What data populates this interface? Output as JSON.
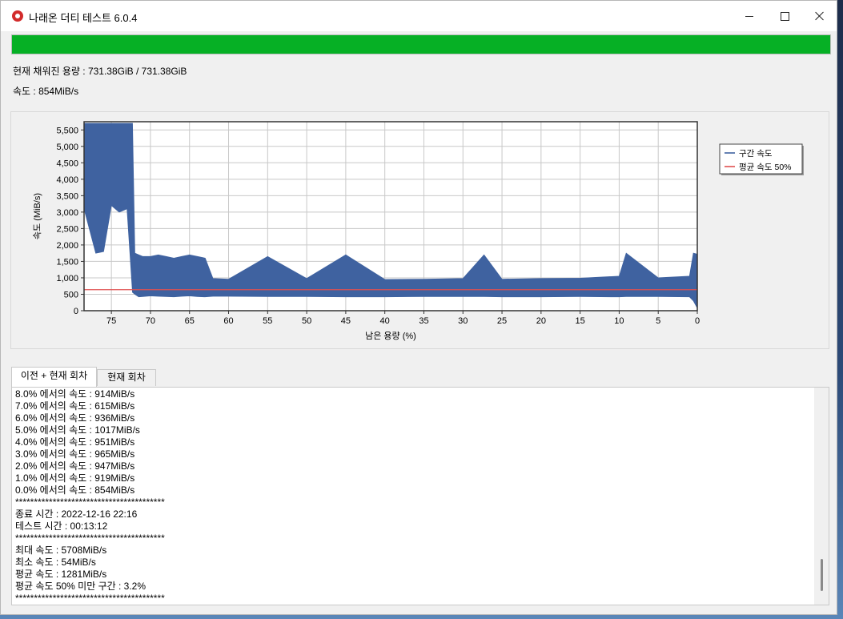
{
  "window": {
    "title": "나래온 더티 테스트 6.0.4",
    "icon": "app-logo-icon"
  },
  "controls": {
    "minimize_icon": "minimize-icon",
    "maximize_icon": "maximize-icon",
    "close_icon": "close-icon"
  },
  "progress": {
    "value": 1.0,
    "color": "#06b025"
  },
  "status": {
    "filled": "현재 채워진 용량 : 731.38GiB / 731.38GiB",
    "speed": "속도 : 854MiB/s"
  },
  "chart_data": {
    "type": "line",
    "xlabel": "남은 용량 (%)",
    "ylabel": "속도 (MiB/s)",
    "xlim": [
      78.5,
      0
    ],
    "ylim": [
      0,
      5750
    ],
    "x_ticks": [
      75,
      70,
      65,
      60,
      55,
      50,
      45,
      40,
      35,
      30,
      25,
      20,
      15,
      10,
      5,
      0
    ],
    "y_ticks": [
      0,
      500,
      1000,
      1500,
      2000,
      2500,
      3000,
      3500,
      4000,
      4500,
      5000,
      5500
    ],
    "y_tick_labels": [
      "0",
      "500",
      "1,000",
      "1,500",
      "2,000",
      "2,500",
      "3,000",
      "3,500",
      "4,000",
      "4,500",
      "5,000",
      "5,500"
    ],
    "grid": true,
    "legend_placement": "right",
    "series": [
      {
        "name": "구간 속도",
        "color": "#3f62a0",
        "x": [
          78.5,
          77,
          76,
          75,
          74,
          73,
          72.3,
          72,
          71.5,
          71,
          70,
          69,
          68,
          67,
          66,
          65,
          64,
          63,
          62,
          60,
          55,
          50,
          45,
          40,
          35,
          30,
          27.3,
          25,
          20,
          15,
          10,
          9.1,
          5,
          1,
          0.5,
          0
        ],
        "min": [
          3100,
          1750,
          1800,
          3200,
          3000,
          3100,
          560,
          500,
          420,
          430,
          450,
          440,
          430,
          420,
          440,
          450,
          430,
          420,
          440,
          440,
          430,
          430,
          420,
          420,
          430,
          430,
          430,
          420,
          420,
          430,
          420,
          430,
          430,
          420,
          300,
          80
        ],
        "max": [
          5700,
          5700,
          5700,
          5700,
          5700,
          5700,
          5700,
          1750,
          1700,
          1650,
          1650,
          1700,
          1650,
          1600,
          1650,
          1700,
          1650,
          1600,
          980,
          960,
          1650,
          980,
          1700,
          950,
          960,
          980,
          1700,
          960,
          980,
          990,
          1050,
          1750,
          1000,
          1050,
          1750,
          1720
        ]
      },
      {
        "name": "평균 속도 50%",
        "color": "#e05050",
        "x": [
          78.5,
          0
        ],
        "y": [
          640,
          640
        ]
      }
    ]
  },
  "tabs": [
    {
      "label": "이전 + 현재 회차",
      "active": true
    },
    {
      "label": "현재 회차",
      "active": false
    }
  ],
  "log": [
    "8.0% 에서의 속도 : 914MiB/s",
    "7.0% 에서의 속도 : 615MiB/s",
    "6.0% 에서의 속도 : 936MiB/s",
    "5.0% 에서의 속도 : 1017MiB/s",
    "4.0% 에서의 속도 : 951MiB/s",
    "3.0% 에서의 속도 : 965MiB/s",
    "2.0% 에서의 속도 : 947MiB/s",
    "1.0% 에서의 속도 : 919MiB/s",
    "0.0% 에서의 속도 : 854MiB/s",
    "****************************************",
    "종료 시간 : 2022-12-16 22:16",
    "테스트 시간 : 00:13:12",
    "****************************************",
    "최대 속도 : 5708MiB/s",
    "최소 속도 : 54MiB/s",
    "평균 속도 : 1281MiB/s",
    "평균 속도 50% 미만 구간 : 3.2%",
    "****************************************"
  ]
}
